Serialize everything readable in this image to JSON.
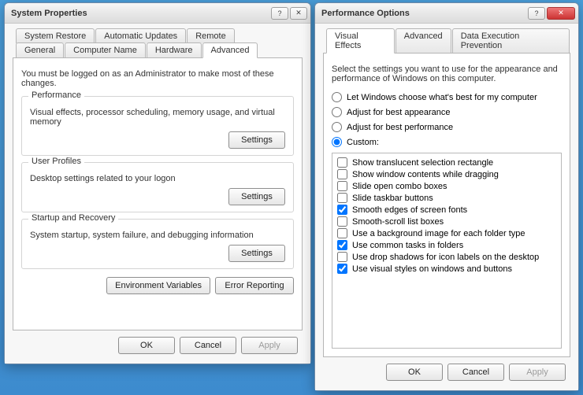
{
  "window1": {
    "title": "System Properties",
    "tabsRow1": [
      "System Restore",
      "Automatic Updates",
      "Remote"
    ],
    "tabsRow2": [
      "General",
      "Computer Name",
      "Hardware",
      "Advanced"
    ],
    "activeTab": "Advanced",
    "note": "You must be logged on as an Administrator to make most of these changes.",
    "groups": {
      "performance": {
        "legend": "Performance",
        "desc": "Visual effects, processor scheduling, memory usage, and virtual memory",
        "button": "Settings"
      },
      "userProfiles": {
        "legend": "User Profiles",
        "desc": "Desktop settings related to your logon",
        "button": "Settings"
      },
      "startup": {
        "legend": "Startup and Recovery",
        "desc": "System startup, system failure, and debugging information",
        "button": "Settings"
      }
    },
    "envBtn": "Environment Variables",
    "errBtn": "Error Reporting",
    "ok": "OK",
    "cancel": "Cancel",
    "apply": "Apply"
  },
  "window2": {
    "title": "Performance Options",
    "tabs": [
      "Visual Effects",
      "Advanced",
      "Data Execution Prevention"
    ],
    "activeTab": "Visual Effects",
    "intro": "Select the settings you want to use for the appearance and performance of Windows on this computer.",
    "radios": {
      "r1": "Let Windows choose what's best for my computer",
      "r2": "Adjust for best appearance",
      "r3": "Adjust for best performance",
      "r4": "Custom:"
    },
    "selectedRadio": "r4",
    "checks": [
      {
        "label": "Show translucent selection rectangle",
        "checked": false
      },
      {
        "label": "Show window contents while dragging",
        "checked": false
      },
      {
        "label": "Slide open combo boxes",
        "checked": false
      },
      {
        "label": "Slide taskbar buttons",
        "checked": false
      },
      {
        "label": "Smooth edges of screen fonts",
        "checked": true
      },
      {
        "label": "Smooth-scroll list boxes",
        "checked": false
      },
      {
        "label": "Use a background image for each folder type",
        "checked": false
      },
      {
        "label": "Use common tasks in folders",
        "checked": true
      },
      {
        "label": "Use drop shadows for icon labels on the desktop",
        "checked": false
      },
      {
        "label": "Use visual styles on windows and buttons",
        "checked": true
      }
    ],
    "ok": "OK",
    "cancel": "Cancel",
    "apply": "Apply"
  }
}
